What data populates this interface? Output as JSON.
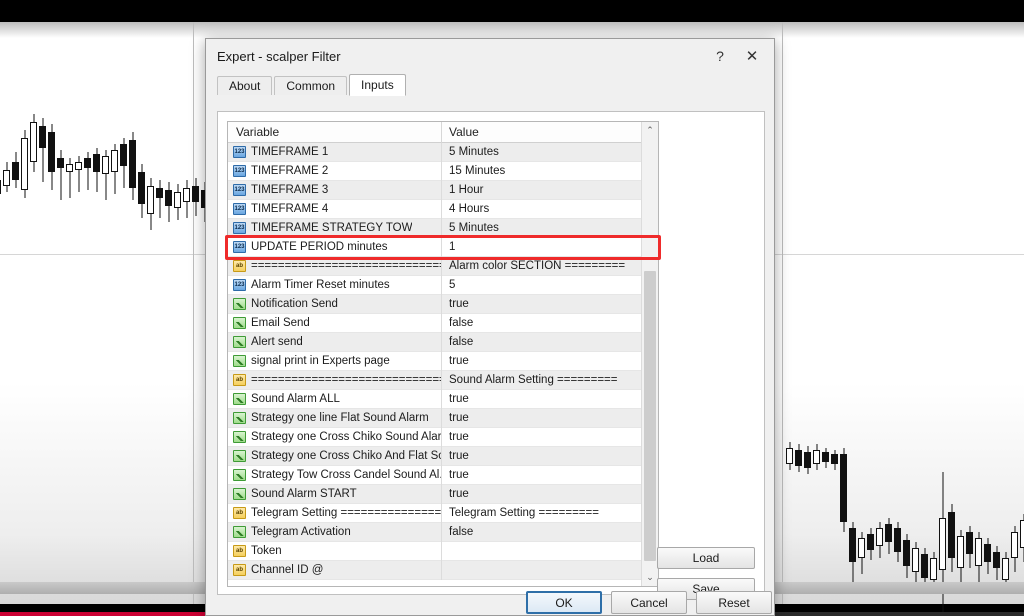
{
  "window": {
    "title": "Expert - scalper Filter",
    "help_label": "?",
    "close_label": "✕"
  },
  "tabs": [
    {
      "label": "About",
      "active": false
    },
    {
      "label": "Common",
      "active": false
    },
    {
      "label": "Inputs",
      "active": true
    }
  ],
  "grid": {
    "columns": [
      "Variable",
      "Value"
    ],
    "rows": [
      {
        "icon": "number-type-icon",
        "type": "num",
        "glyph": "123",
        "variable": "TIMEFRAME 1",
        "value": "5 Minutes"
      },
      {
        "icon": "number-type-icon",
        "type": "num",
        "glyph": "123",
        "variable": "TIMEFRAME 2",
        "value": "15 Minutes"
      },
      {
        "icon": "number-type-icon",
        "type": "num",
        "glyph": "123",
        "variable": "TIMEFRAME 3",
        "value": "1 Hour"
      },
      {
        "icon": "number-type-icon",
        "type": "num",
        "glyph": "123",
        "variable": "TIMEFRAME 4",
        "value": "4 Hours"
      },
      {
        "icon": "number-type-icon",
        "type": "num",
        "glyph": "123",
        "variable": "TIMEFRAME STRATEGY TOW",
        "value": "5 Minutes"
      },
      {
        "icon": "number-type-icon",
        "type": "num",
        "glyph": "123",
        "variable": "UPDATE PERIOD minutes",
        "value": "1",
        "highlighted": true
      },
      {
        "icon": "string-type-icon",
        "type": "str",
        "glyph": "ab",
        "variable": "=================================",
        "value": "Alarm color SECTION ========="
      },
      {
        "icon": "number-type-icon",
        "type": "num",
        "glyph": "123",
        "variable": "Alarm Timer Reset minutes",
        "value": "5"
      },
      {
        "icon": "bool-type-icon",
        "type": "bool",
        "glyph": "",
        "variable": "Notification Send",
        "value": "true"
      },
      {
        "icon": "bool-type-icon",
        "type": "bool",
        "glyph": "",
        "variable": "Email Send",
        "value": "false"
      },
      {
        "icon": "bool-type-icon",
        "type": "bool",
        "glyph": "",
        "variable": "Alert send",
        "value": "false"
      },
      {
        "icon": "bool-type-icon",
        "type": "bool",
        "glyph": "",
        "variable": "signal print in Experts page",
        "value": "true"
      },
      {
        "icon": "string-type-icon",
        "type": "str",
        "glyph": "ab",
        "variable": "=================================",
        "value": "Sound Alarm Setting ========="
      },
      {
        "icon": "bool-type-icon",
        "type": "bool",
        "glyph": "",
        "variable": "Sound Alarm ALL",
        "value": "true"
      },
      {
        "icon": "bool-type-icon",
        "type": "bool",
        "glyph": "",
        "variable": "Strategy one line Flat Sound Alarm",
        "value": "true"
      },
      {
        "icon": "bool-type-icon",
        "type": "bool",
        "glyph": "",
        "variable": "Strategy one Cross Chiko Sound Alarm",
        "value": "true"
      },
      {
        "icon": "bool-type-icon",
        "type": "bool",
        "glyph": "",
        "variable": "Strategy one Cross Chiko And Flat  So...",
        "value": "true"
      },
      {
        "icon": "bool-type-icon",
        "type": "bool",
        "glyph": "",
        "variable": "Strategy Tow Cross Candel  Sound Al...",
        "value": "true"
      },
      {
        "icon": "bool-type-icon",
        "type": "bool",
        "glyph": "",
        "variable": "Sound Alarm START",
        "value": "true"
      },
      {
        "icon": "string-type-icon",
        "type": "str",
        "glyph": "ab",
        "variable": "Telegram Setting =================",
        "value": "Telegram Setting ========="
      },
      {
        "icon": "bool-type-icon",
        "type": "bool",
        "glyph": "",
        "variable": "Telegram Activation",
        "value": "false"
      },
      {
        "icon": "string-type-icon",
        "type": "str",
        "glyph": "ab",
        "variable": "Token",
        "value": ""
      },
      {
        "icon": "string-type-icon",
        "type": "str",
        "glyph": "ab",
        "variable": "Channel ID @",
        "value": ""
      }
    ]
  },
  "scrollbar": {
    "up_arrow": "⌃",
    "down_arrow": "⌄"
  },
  "buttons": {
    "load": "Load",
    "save": "Save",
    "ok": "OK",
    "cancel": "Cancel",
    "reset": "Reset"
  },
  "annotation": {
    "target_row": "UPDATE PERIOD minutes",
    "color": "#ef2b2b"
  },
  "colors": {
    "dialog_bg": "#f0f0f0",
    "row_alt": "#ededed",
    "row_white": "#ffffff",
    "accent_focus": "#2f6fa8",
    "annotation_red": "#ef2b2b",
    "progress_red": "#cc0033"
  }
}
